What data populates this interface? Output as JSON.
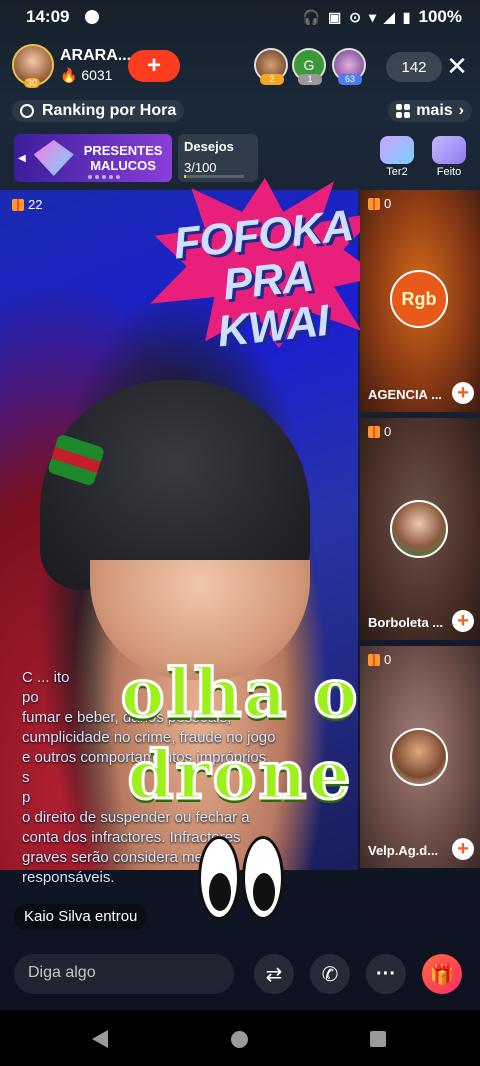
{
  "status": {
    "time": "14:09",
    "battery": "100%"
  },
  "host": {
    "name": "ARARA...",
    "fans": "6031",
    "level": "30"
  },
  "viewers": [
    {
      "letter": "",
      "badge": "2",
      "badge_color": "#f5a623"
    },
    {
      "letter": "G",
      "badge": "1",
      "badge_color": "#f5a623"
    },
    {
      "letter": "",
      "badge": "63",
      "badge_color": "#4a7cf5"
    }
  ],
  "viewer_count": "142",
  "ranking": {
    "label": "Ranking por Hora",
    "more": "mais"
  },
  "banner": {
    "line1": "PRESENTES",
    "line2": "MALUCOS"
  },
  "wishes": {
    "title": "Desejos",
    "count": "3/100",
    "progress": 0.03
  },
  "side_badges": [
    {
      "label": "Ter2"
    },
    {
      "label": "Feito"
    }
  ],
  "main_video": {
    "gifts": "22"
  },
  "sticker": {
    "line1": "FOFOKA",
    "line2": "PRA KWAI"
  },
  "comment_lines": [
    "C      ...      ito            ",
    "po                             ",
    "fumar e beber, danos pessoais,",
    "cumplicidade no crime, fraude no jogo",
    "e outros comportamentos impróprios",
    "s                                   ",
    "p                                   ",
    "o direito de suspender ou fechar a",
    "conta dos infractores. Infractores",
    "graves serão considera         mente",
    "responsáveis."
  ],
  "caption": {
    "line1": "olha o",
    "line2": "drone"
  },
  "tiles": [
    {
      "gifts": "0",
      "label": "AGENCIA ...",
      "avatar_text": "Rgb"
    },
    {
      "gifts": "0",
      "label": "Borboleta ..."
    },
    {
      "gifts": "0",
      "label": "Velp.Ag.d..."
    }
  ],
  "join_message": "Kaio Silva entrou",
  "input": {
    "placeholder": "Diga algo"
  }
}
